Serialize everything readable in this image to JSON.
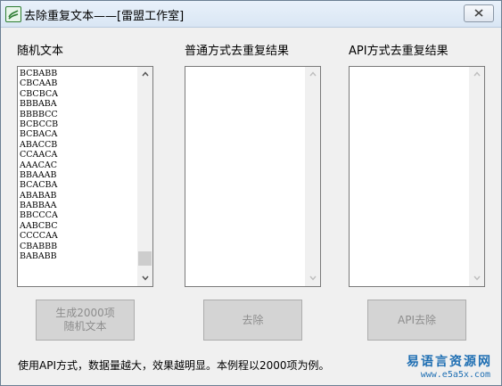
{
  "window": {
    "title": "去除重复文本——[雷盟工作室]"
  },
  "columns": {
    "random_text": {
      "label": "随机文本"
    },
    "normal_result": {
      "label": "普通方式去重复结果"
    },
    "api_result": {
      "label": "API方式去重复结果"
    }
  },
  "random_list": {
    "items": [
      "BCBABB",
      "CBCAAB",
      "CBCBCA",
      "BBBABA",
      "BBBBCC",
      "BCBCCB",
      "BCBACA",
      "ABACCB",
      "CCAACA",
      "AAACAC",
      "BBAAAB",
      "BCACBA",
      "ABABAB",
      "BABBAA",
      "BBCCCA",
      "AABCBC",
      "CCCCAA",
      "CBABBB",
      "BABABB"
    ],
    "scroll_position": 0.97
  },
  "buttons": {
    "generate_line1": "生成2000项",
    "generate_line2": "随机文本",
    "remove": "去除",
    "api_remove": "API去除"
  },
  "footer": {
    "note": "使用API方式，数据量越大，效果越明显。本例程以2000项为例。",
    "watermark": "易语言资源网",
    "watermark_url": "www.e5a5x.com"
  }
}
